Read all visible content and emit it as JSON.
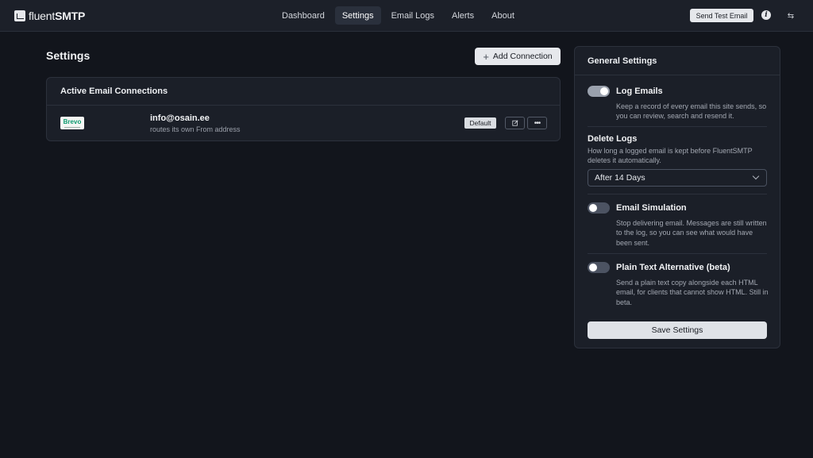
{
  "header": {
    "logo_text_light": "fluent",
    "logo_text_bold": "SMTP",
    "nav": [
      {
        "label": "Dashboard"
      },
      {
        "label": "Settings"
      },
      {
        "label": "Email Logs"
      },
      {
        "label": "Alerts"
      },
      {
        "label": "About"
      }
    ],
    "active_nav": "Settings",
    "send_test_label": "Send Test Email",
    "info_icon": "info-icon",
    "swap_icon": "swap-icon"
  },
  "page": {
    "title": "Settings",
    "add_connection_label": "Add Connection"
  },
  "connections": {
    "title": "Active Email Connections",
    "items": [
      {
        "provider_logo": "Brevo",
        "email": "info@osain.ee",
        "description": "routes its own From address",
        "badge": "Default",
        "edit_icon": "edit-icon",
        "more_icon": "more-icon"
      }
    ]
  },
  "general_settings": {
    "title": "General Settings",
    "log_emails": {
      "label": "Log Emails",
      "enabled": true,
      "description": "Keep a record of every email this site sends, so you can review, search and resend it."
    },
    "delete_logs": {
      "label": "Delete Logs",
      "description": "How long a logged email is kept before FluentSMTP deletes it automatically.",
      "selected": "After 14 Days"
    },
    "email_simulation": {
      "label": "Email Simulation",
      "enabled": false,
      "description": "Stop delivering email. Messages are still written to the log, so you can see what would have been sent."
    },
    "plain_text": {
      "label": "Plain Text Alternative (beta)",
      "enabled": false,
      "description": "Send a plain text copy alongside each HTML email, for clients that cannot show HTML. Still in beta."
    },
    "save_label": "Save Settings"
  },
  "colors": {
    "background": "#12151c",
    "surface": "#1b1f28",
    "border": "#2c313c",
    "button_light": "#e6e8ec",
    "brevo_green": "#0b996e"
  }
}
